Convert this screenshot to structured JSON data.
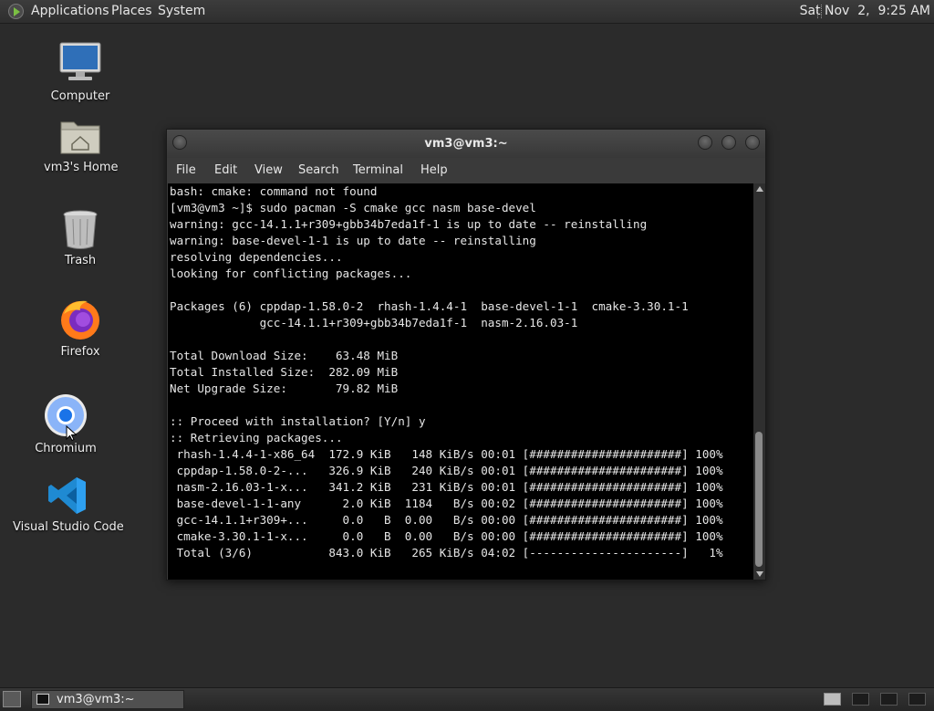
{
  "top_panel": {
    "menus": [
      "Applications",
      "Places",
      "System"
    ],
    "clock": "Sat Nov  2,  9:25 AM"
  },
  "desktop_icons": [
    {
      "label": "Computer",
      "icon": "computer-icon"
    },
    {
      "label": "vm3's Home",
      "icon": "home-folder-icon"
    },
    {
      "label": "Trash",
      "icon": "trash-icon"
    },
    {
      "label": "Firefox",
      "icon": "firefox-icon"
    },
    {
      "label": "Chromium",
      "icon": "chromium-icon"
    },
    {
      "label": "Visual Studio Code",
      "icon": "vscode-icon"
    }
  ],
  "terminal": {
    "title": "vm3@vm3:~",
    "menu": [
      "File",
      "Edit",
      "View",
      "Search",
      "Terminal",
      "Help"
    ],
    "lines": [
      "bash: cmake: command not found",
      "[vm3@vm3 ~]$ sudo pacman -S cmake gcc nasm base-devel",
      "warning: gcc-14.1.1+r309+gbb34b7eda1f-1 is up to date -- reinstalling",
      "warning: base-devel-1-1 is up to date -- reinstalling",
      "resolving dependencies...",
      "looking for conflicting packages...",
      "",
      "Packages (6) cppdap-1.58.0-2  rhash-1.4.4-1  base-devel-1-1  cmake-3.30.1-1",
      "             gcc-14.1.1+r309+gbb34b7eda1f-1  nasm-2.16.03-1",
      "",
      "Total Download Size:    63.48 MiB",
      "Total Installed Size:  282.09 MiB",
      "Net Upgrade Size:       79.82 MiB",
      "",
      ":: Proceed with installation? [Y/n] y",
      ":: Retrieving packages...",
      " rhash-1.4.4-1-x86_64  172.9 KiB   148 KiB/s 00:01 [######################] 100%",
      " cppdap-1.58.0-2-...   326.9 KiB   240 KiB/s 00:01 [######################] 100%",
      " nasm-2.16.03-1-x...   341.2 KiB   231 KiB/s 00:01 [######################] 100%",
      " base-devel-1-1-any      2.0 KiB  1184   B/s 00:02 [######################] 100%",
      " gcc-14.1.1+r309+...     0.0   B  0.00   B/s 00:00 [######################] 100%",
      " cmake-3.30.1-1-x...     0.0   B  0.00   B/s 00:00 [######################] 100%",
      " Total (3/6)           843.0 KiB   265 KiB/s 04:02 [----------------------]   1%"
    ]
  },
  "taskbar": {
    "task_label": "vm3@vm3:~"
  },
  "colors": {
    "desktop_bg": "#2b2b2b",
    "terminal_bg": "#000000",
    "terminal_fg": "#e6e6e6",
    "panel_bg": "#333333"
  }
}
